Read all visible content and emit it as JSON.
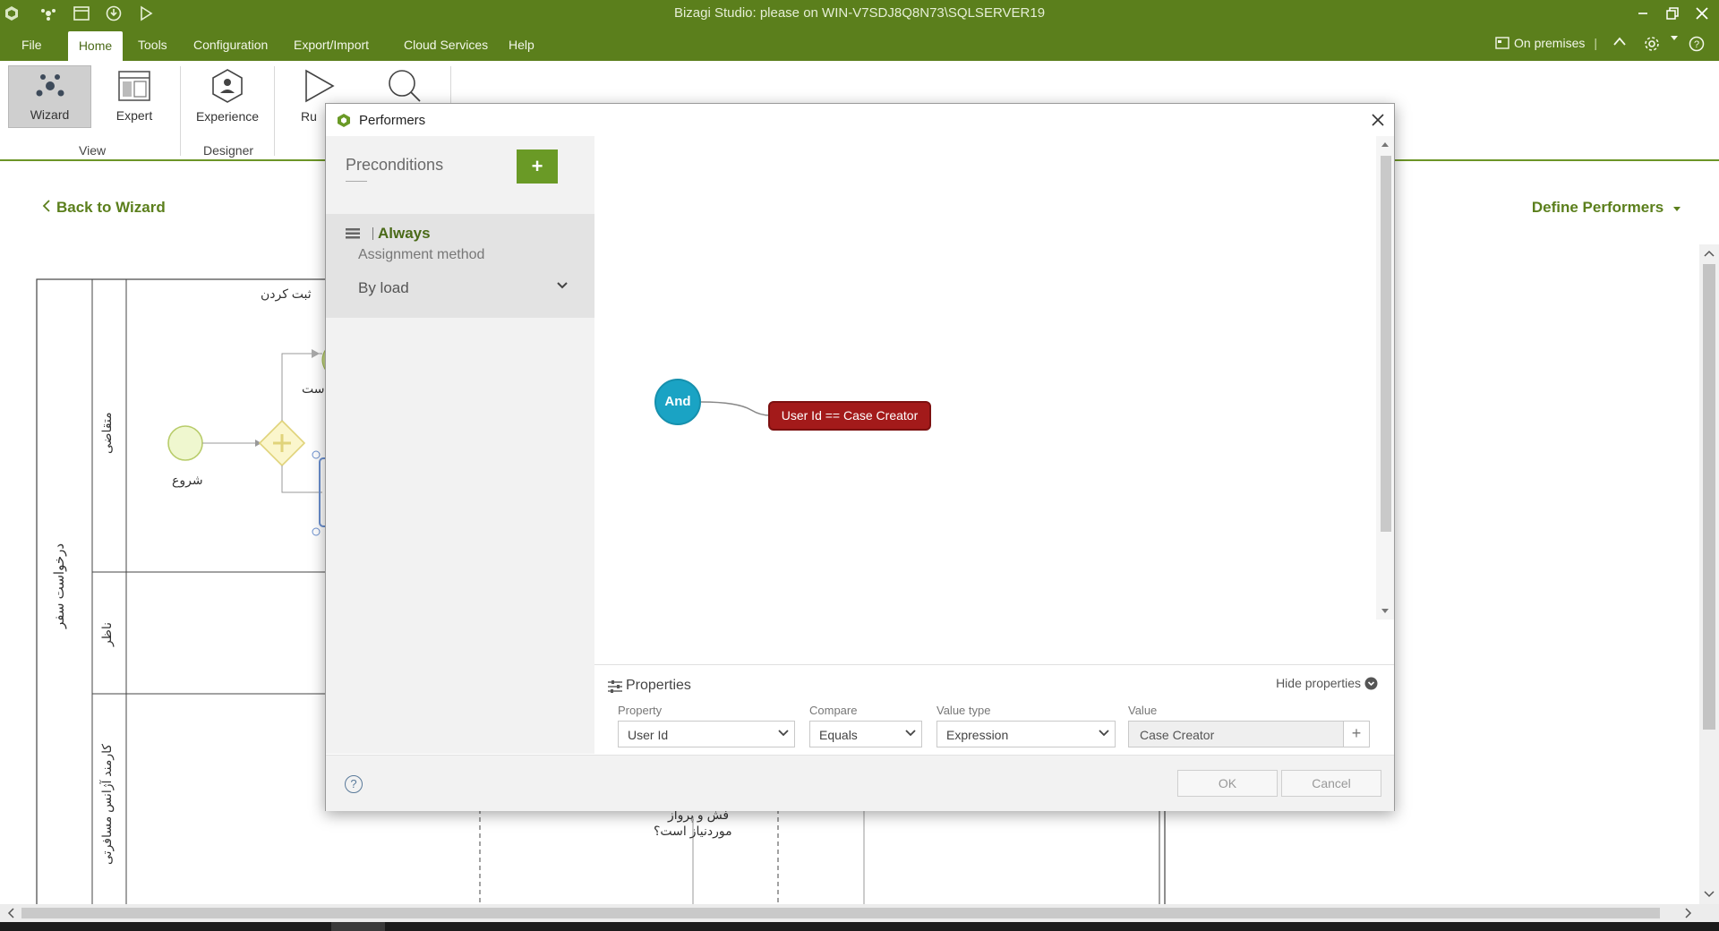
{
  "window": {
    "title": "Bizagi Studio: please  on WIN-V7SDJ8Q8N73\\SQLSERVER19"
  },
  "menu": {
    "items": [
      "File",
      "Home",
      "Tools",
      "Configuration",
      "Export/Import",
      "Cloud Services",
      "Help"
    ],
    "on_premises": "On premises"
  },
  "ribbon": {
    "wizard": "Wizard",
    "expert": "Expert",
    "experience": "Experience",
    "run": "Ru",
    "group_view": "View",
    "group_designer": "Designer"
  },
  "canvas": {
    "back_link": "Back to Wizard",
    "define_performers": "Define Performers",
    "pool_label": "درخواست سفر",
    "lane1": "متقاضی",
    "lane2": "ناظر",
    "lane3": "کارمند آژانس مسافرتی",
    "task_register": "ثبت کردن",
    "start_label": "شروع",
    "partial_text": "است",
    "bottom_text1": "فش و پرواز",
    "bottom_text2": "موردنیاز است؟"
  },
  "dialog": {
    "title": "Performers",
    "preconditions": "Preconditions",
    "add_label": "+",
    "condition": {
      "name": "Always",
      "assignment_label": "Assignment method",
      "assignment_value": "By load"
    },
    "diagram": {
      "and_node": "And",
      "condition_node": "User Id == Case Creator"
    },
    "properties": {
      "title": "Properties",
      "hide_label": "Hide properties",
      "property_label": "Property",
      "property_value": "User Id",
      "compare_label": "Compare",
      "compare_value": "Equals",
      "value_type_label": "Value type",
      "value_type_value": "Expression",
      "value_label": "Value",
      "value_value": "Case Creator"
    },
    "footer": {
      "help": "?",
      "ok": "OK",
      "cancel": "Cancel"
    }
  },
  "colors": {
    "brand_green": "#5b7f1c",
    "and_node": "#1aa3c4",
    "condition_node": "#a31a1a"
  }
}
